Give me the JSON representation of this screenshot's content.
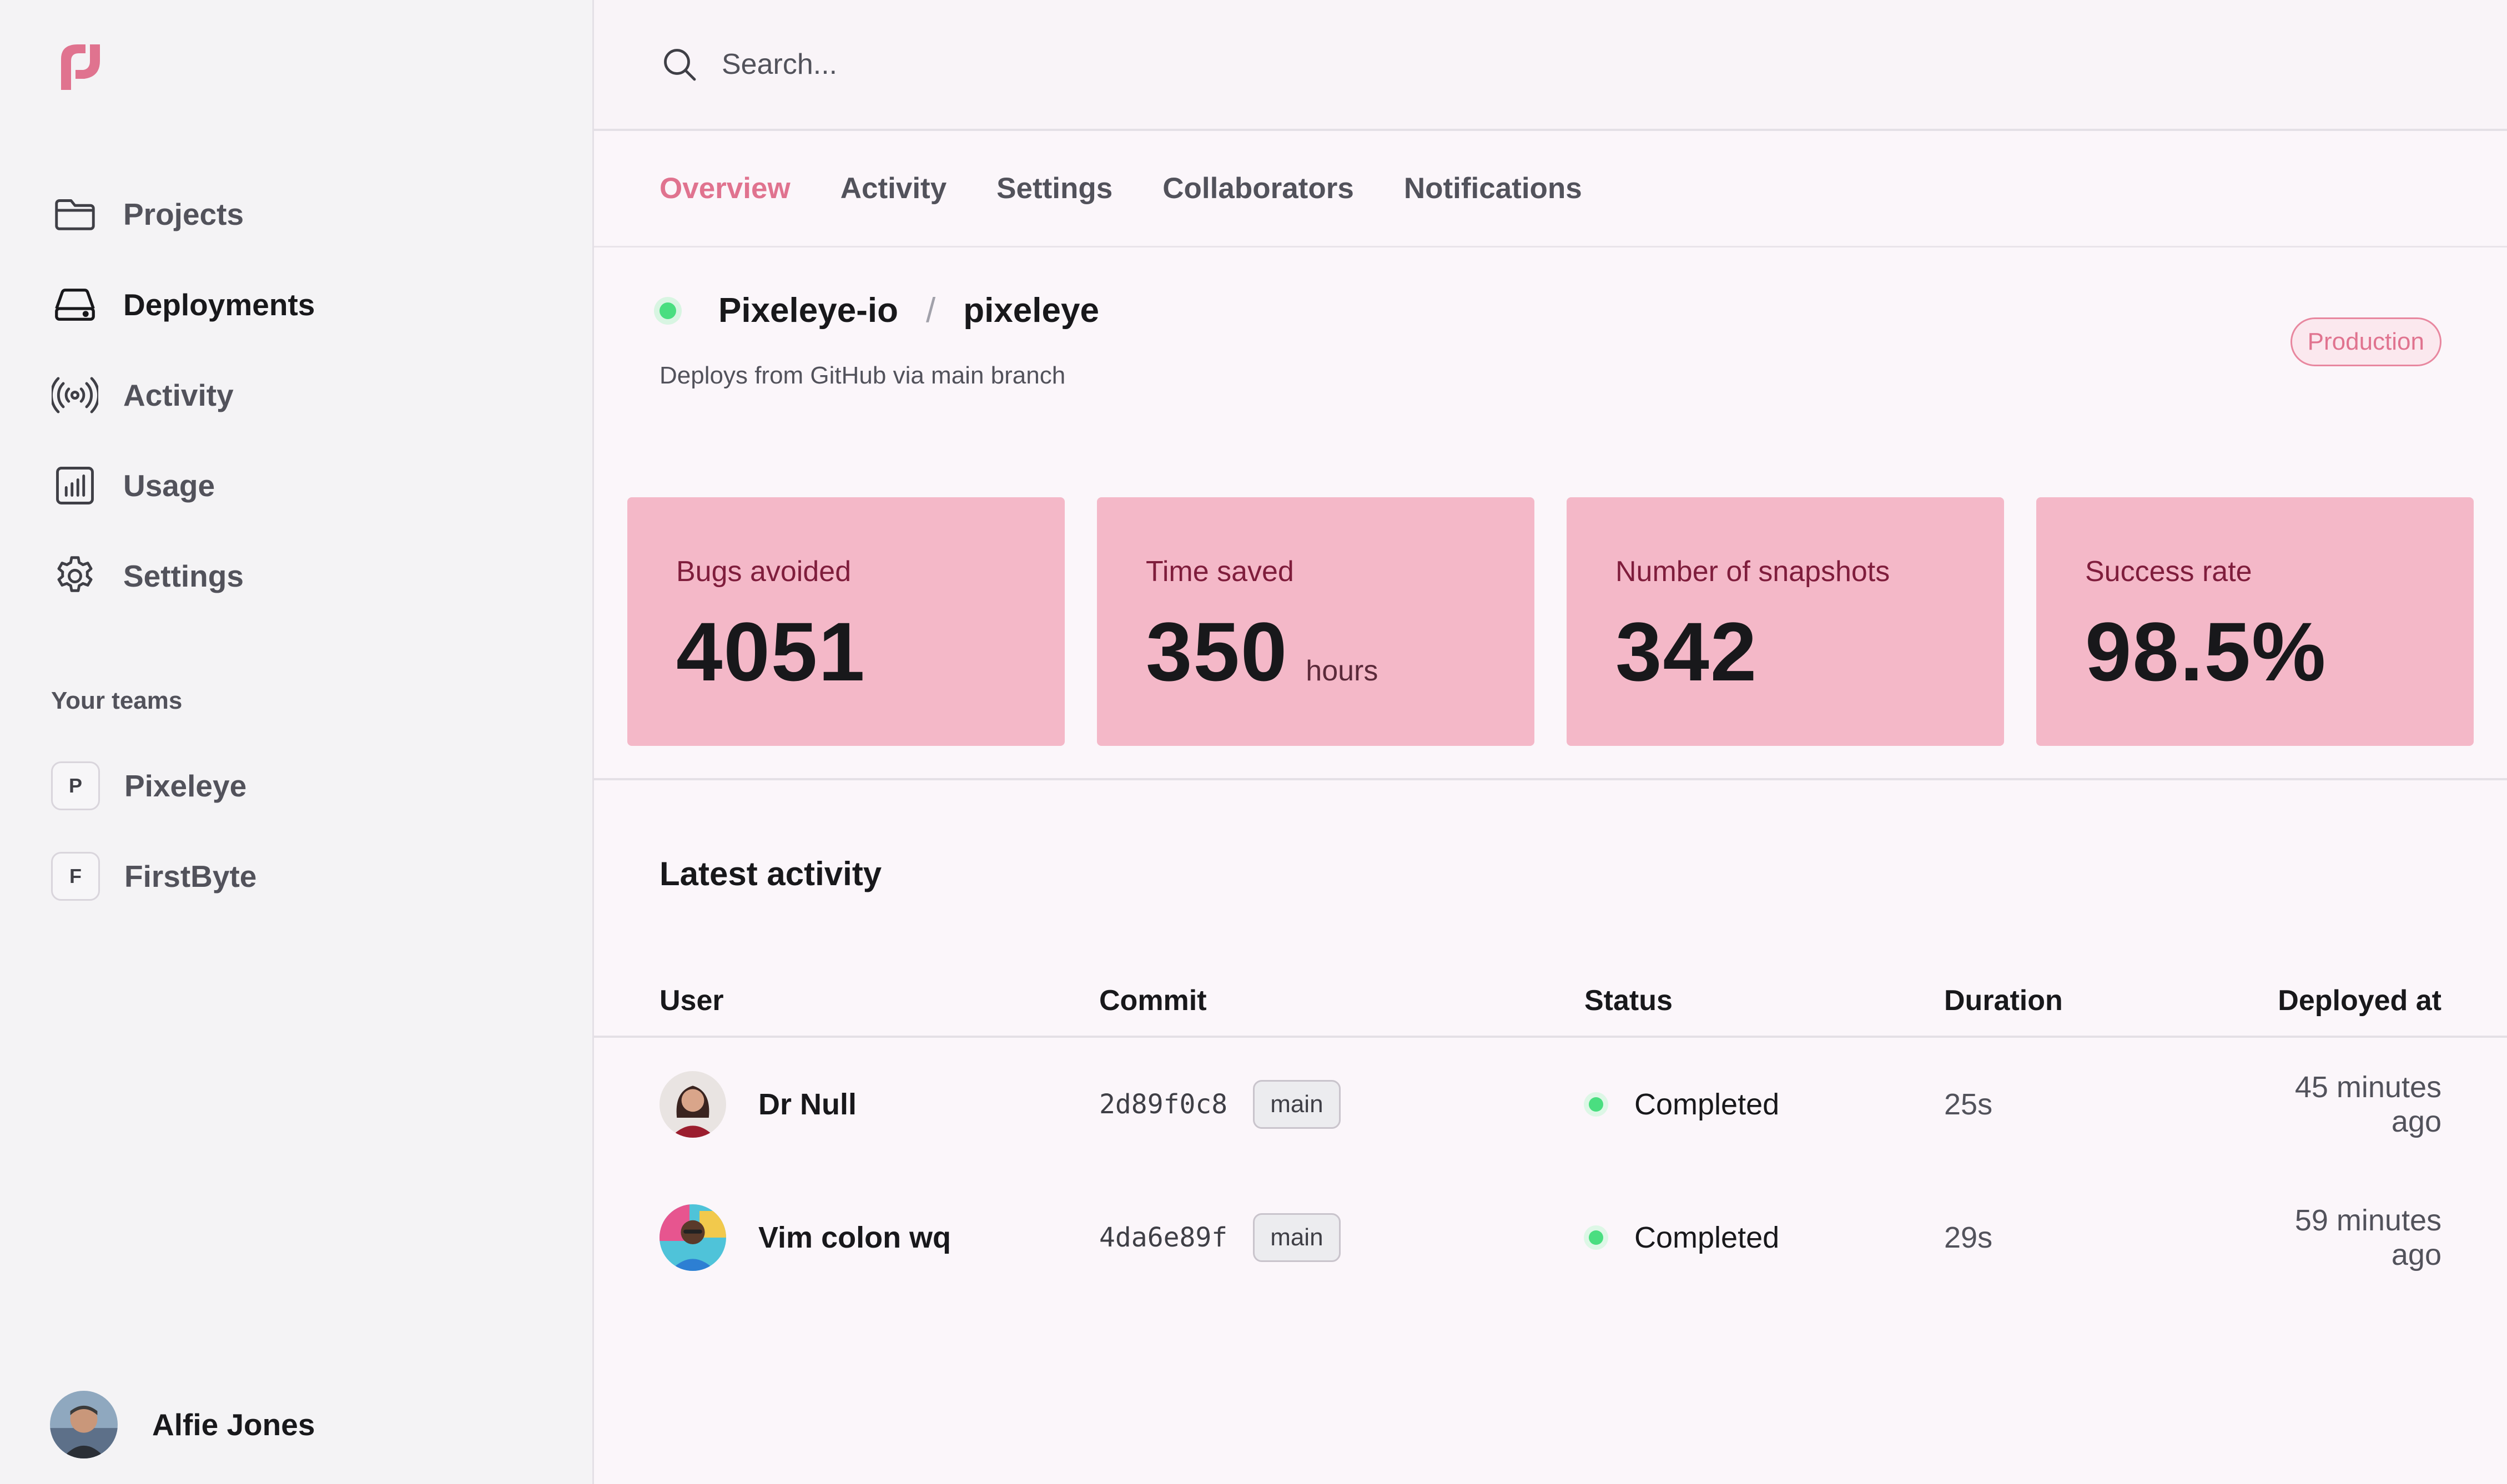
{
  "sidebar": {
    "nav": [
      {
        "label": "Projects",
        "icon": "folder-icon"
      },
      {
        "label": "Deployments",
        "icon": "server-icon"
      },
      {
        "label": "Activity",
        "icon": "broadcast-icon"
      },
      {
        "label": "Usage",
        "icon": "bar-chart-icon"
      },
      {
        "label": "Settings",
        "icon": "gear-icon"
      }
    ],
    "active_nav": "Deployments",
    "teams_title": "Your teams",
    "teams": [
      {
        "initial": "P",
        "name": "Pixeleye"
      },
      {
        "initial": "F",
        "name": "FirstByte"
      }
    ],
    "user": {
      "name": "Alfie Jones"
    }
  },
  "search": {
    "placeholder": "Search..."
  },
  "tabs": [
    {
      "label": "Overview",
      "active": true
    },
    {
      "label": "Activity",
      "active": false
    },
    {
      "label": "Settings",
      "active": false
    },
    {
      "label": "Collaborators",
      "active": false
    },
    {
      "label": "Notifications",
      "active": false
    }
  ],
  "project": {
    "org": "Pixeleye-io",
    "separator": "/",
    "repo": "pixeleye",
    "note": "Deploys from GitHub via main branch",
    "environment": "Production"
  },
  "stats": [
    {
      "label": "Bugs avoided",
      "value": "4051",
      "unit": ""
    },
    {
      "label": "Time saved",
      "value": "350",
      "unit": "hours"
    },
    {
      "label": "Number of snapshots",
      "value": "342",
      "unit": ""
    },
    {
      "label": "Success rate",
      "value": "98.5%",
      "unit": ""
    }
  ],
  "activity": {
    "title": "Latest activity",
    "columns": {
      "user": "User",
      "commit": "Commit",
      "status": "Status",
      "duration": "Duration",
      "deployed": "Deployed at"
    },
    "rows": [
      {
        "user": "Dr Null",
        "commit": "2d89f0c8",
        "branch": "main",
        "status": "Completed",
        "duration": "25s",
        "deployed": "45 minutes ago"
      },
      {
        "user": "Vim colon wq",
        "commit": "4da6e89f",
        "branch": "main",
        "status": "Completed",
        "duration": "29s",
        "deployed": "59 minutes ago"
      }
    ]
  },
  "colors": {
    "accent": "#e0738f",
    "card": "#f4b8c8",
    "success": "#4ade80"
  }
}
